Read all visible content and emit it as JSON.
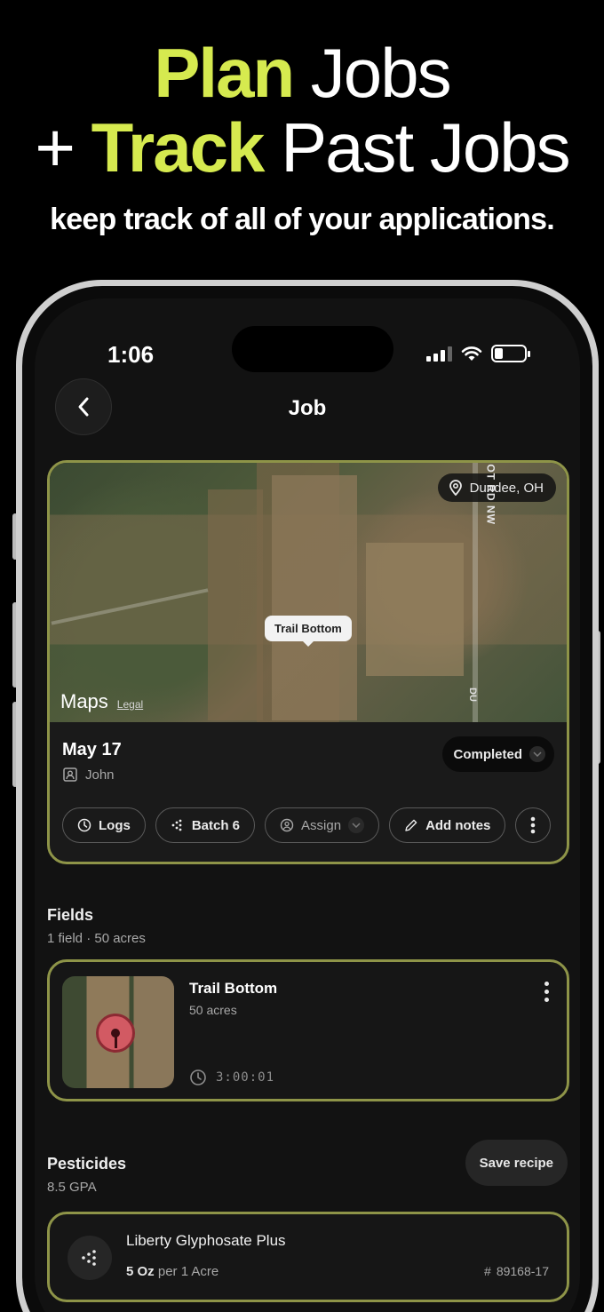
{
  "hero": {
    "line1_accent": "Plan",
    "line1_rest": " Jobs",
    "line2_prefix": "+ ",
    "line2_accent": "Track",
    "line2_rest": " Past Jobs",
    "subtitle": "keep track of all of your applications."
  },
  "status_bar": {
    "time": "1:06"
  },
  "header": {
    "title": "Job"
  },
  "map": {
    "location": "Dundee, OH",
    "field_label": "Trail Bottom",
    "road_name": "DEE WILMOT RD NW",
    "road_name_short": "DU",
    "brand": "Maps",
    "legal": "Legal"
  },
  "job": {
    "date": "May 17",
    "assignee": "John",
    "status": "Completed",
    "actions": {
      "logs": "Logs",
      "batch": "Batch 6",
      "assign": "Assign",
      "add_notes": "Add notes"
    }
  },
  "fields": {
    "title": "Fields",
    "summary": "1 field · 50 acres",
    "items": [
      {
        "name": "Trail Bottom",
        "acres": "50 acres",
        "duration": "3:00:01"
      }
    ]
  },
  "pesticides": {
    "title": "Pesticides",
    "rate": "8.5 GPA",
    "save_recipe": "Save recipe",
    "items": [
      {
        "name": "Liberty Glyphosate Plus",
        "amount": "5 Oz",
        "per": "per 1 Acre",
        "code": "89168-17"
      }
    ]
  },
  "colors": {
    "accent": "#d6ea4f",
    "card_border": "#8e9448",
    "background": "#000000",
    "pin": "#d25a63"
  }
}
